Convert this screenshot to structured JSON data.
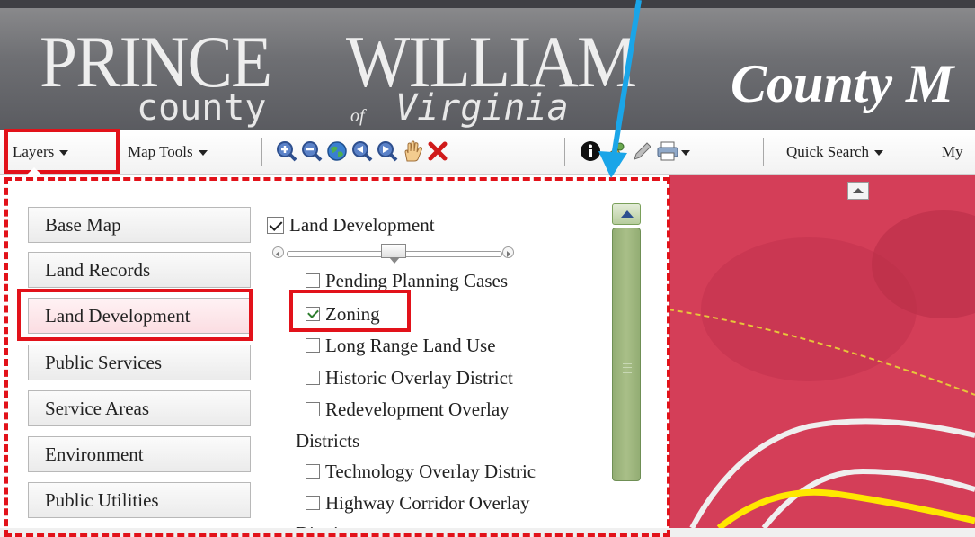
{
  "header": {
    "logo_line1_a": "PRINCE",
    "logo_line1_b": "WILLIAM",
    "logo_line2_a": "county",
    "logo_line2_of": "of",
    "logo_line2_b": "Virginia",
    "title": "County M"
  },
  "toolbar": {
    "layers_label": "Layers",
    "map_tools_label": "Map Tools",
    "quick_search_label": "Quick Search",
    "my_label": "My",
    "tool_icons": [
      "zoom-in-icon",
      "zoom-out-icon",
      "globe-icon",
      "previous-extent-icon",
      "next-extent-icon",
      "pan-hand-icon",
      "clear-icon",
      "identify-icon",
      "measure-icon",
      "draw-pencil-icon",
      "print-icon"
    ]
  },
  "layers_panel": {
    "categories": [
      {
        "label": "Base Map",
        "active": false
      },
      {
        "label": "Land Records",
        "active": false
      },
      {
        "label": "Land Development",
        "active": true
      },
      {
        "label": "Public Services",
        "active": false
      },
      {
        "label": "Service Areas",
        "active": false
      },
      {
        "label": "Environment",
        "active": false
      },
      {
        "label": "Public Utilities",
        "active": false
      }
    ],
    "group_title": "Land Development",
    "group_checked": true,
    "transparency_percent": 50,
    "layers": [
      {
        "label": "Pending Planning Cases",
        "checked": false
      },
      {
        "label": "Zoning",
        "checked": true
      },
      {
        "label": "Long Range Land Use",
        "checked": false
      },
      {
        "label": "Historic Overlay District",
        "checked": false
      },
      {
        "label": "Redevelopment Overlay",
        "checked": false
      },
      {
        "label": "Districts",
        "continuation": true
      },
      {
        "label": "Technology Overlay Distric",
        "checked": false
      },
      {
        "label": "Highway Corridor Overlay",
        "checked": false
      },
      {
        "label": "Districts",
        "continuation": true
      }
    ]
  },
  "colors": {
    "highlight": "#e2121a",
    "arrow": "#1aa5e8",
    "map_zoning": "#d63a55",
    "road_yellow": "#ffe800"
  }
}
